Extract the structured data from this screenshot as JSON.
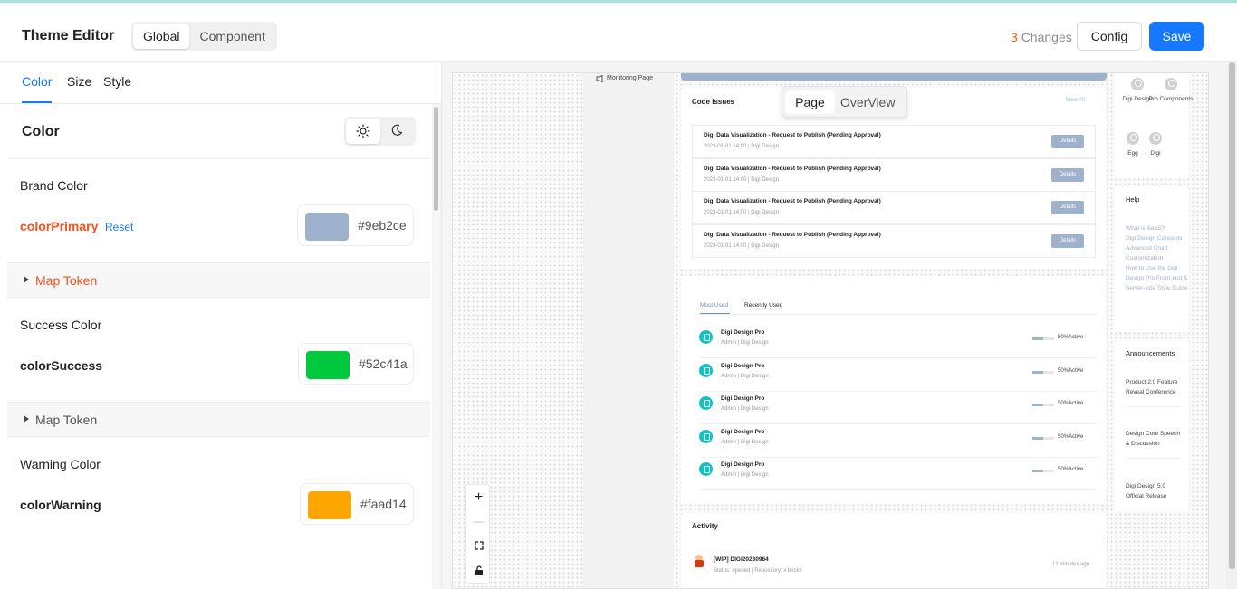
{
  "header": {
    "title": "Theme Editor",
    "mode_tabs": [
      "Global",
      "Component"
    ],
    "changes_count": "3",
    "changes_label": "Changes",
    "config_label": "Config",
    "save_label": "Save"
  },
  "left": {
    "tabs": [
      "Color",
      "Size",
      "Style"
    ],
    "section_title": "Color",
    "brand": {
      "label": "Brand Color",
      "token": "colorPrimary",
      "reset": "Reset",
      "hex": "#9eb2ce",
      "map": "Map Token"
    },
    "success": {
      "label": "Success Color",
      "token": "colorSuccess",
      "hex": "#52c41a",
      "map": "Map Token"
    },
    "warning": {
      "label": "Warning Color",
      "token": "colorWarning",
      "hex": "#faad14"
    }
  },
  "preview": {
    "nav_item": "Monitoring Page",
    "code_issues": {
      "title": "Code Issues",
      "view_all": "View All",
      "items": [
        {
          "title": "Digi Data Visualization - Request to Publish (Pending Approval)",
          "meta": "2023-01-01 14:00 | Digi Design",
          "action": "Details"
        },
        {
          "title": "Digi Data Visualization - Request to Publish (Pending Approval)",
          "meta": "2023-01-01 14:00 | Digi Design",
          "action": "Details"
        },
        {
          "title": "Digi Data Visualization - Request to Publish (Pending Approval)",
          "meta": "2023-01-01 14:00 | Digi Design",
          "action": "Details"
        },
        {
          "title": "Digi Data Visualization - Request to Publish (Pending Approval)",
          "meta": "2023-01-01 14:00 | Digi Design",
          "action": "Details"
        }
      ]
    },
    "view_switch": [
      "Page",
      "OverView"
    ],
    "projects": {
      "tabs": [
        "Most Used",
        "Recently Used"
      ],
      "items": [
        {
          "name": "Digi Design Pro",
          "sub": "Admin | Digi Design",
          "status": "50%Active",
          "progress": 0.5
        },
        {
          "name": "Digi Design Pro",
          "sub": "Admin | Digi Design",
          "status": "50%Active",
          "progress": 0.5
        },
        {
          "name": "Digi Design Pro",
          "sub": "Admin | Digi Design",
          "status": "50%Active",
          "progress": 0.5
        },
        {
          "name": "Digi Design Pro",
          "sub": "Admin | Digi Design",
          "status": "50%Active",
          "progress": 0.5
        },
        {
          "name": "Digi Design Pro",
          "sub": "Admin | Digi Design",
          "status": "50%Active",
          "progress": 0.5
        }
      ]
    },
    "activity": {
      "title": "Activity",
      "item": {
        "title": "[WIP] DIGI20230964",
        "meta": "Status: opened | Repository: x bricks",
        "time": "12 minutes ago"
      }
    },
    "users": [
      "Digi Design",
      "Pro Components",
      "Egg",
      "Digi"
    ],
    "help": {
      "title": "Help",
      "links": [
        "What is SaaS?",
        "Digi Design Concepts",
        "Advanced Chart Customization",
        "How to Use the Digi Design Pro Front-end & Server-side Style Guide"
      ]
    },
    "announcements": {
      "title": "Announcements",
      "items": [
        "Product 2.0 Feature Reveal Conference",
        "Design Core Speech & Discussion",
        "Digi Design 5.0 Official Release"
      ]
    },
    "zoom": {
      "zoom_in": "+",
      "zoom_out": "—"
    }
  },
  "colors": {
    "brand": "#9eb2ce",
    "success": "#52c41a",
    "warning": "#faad14",
    "primary_button": "#1677ff",
    "accent": "#f4511e"
  }
}
